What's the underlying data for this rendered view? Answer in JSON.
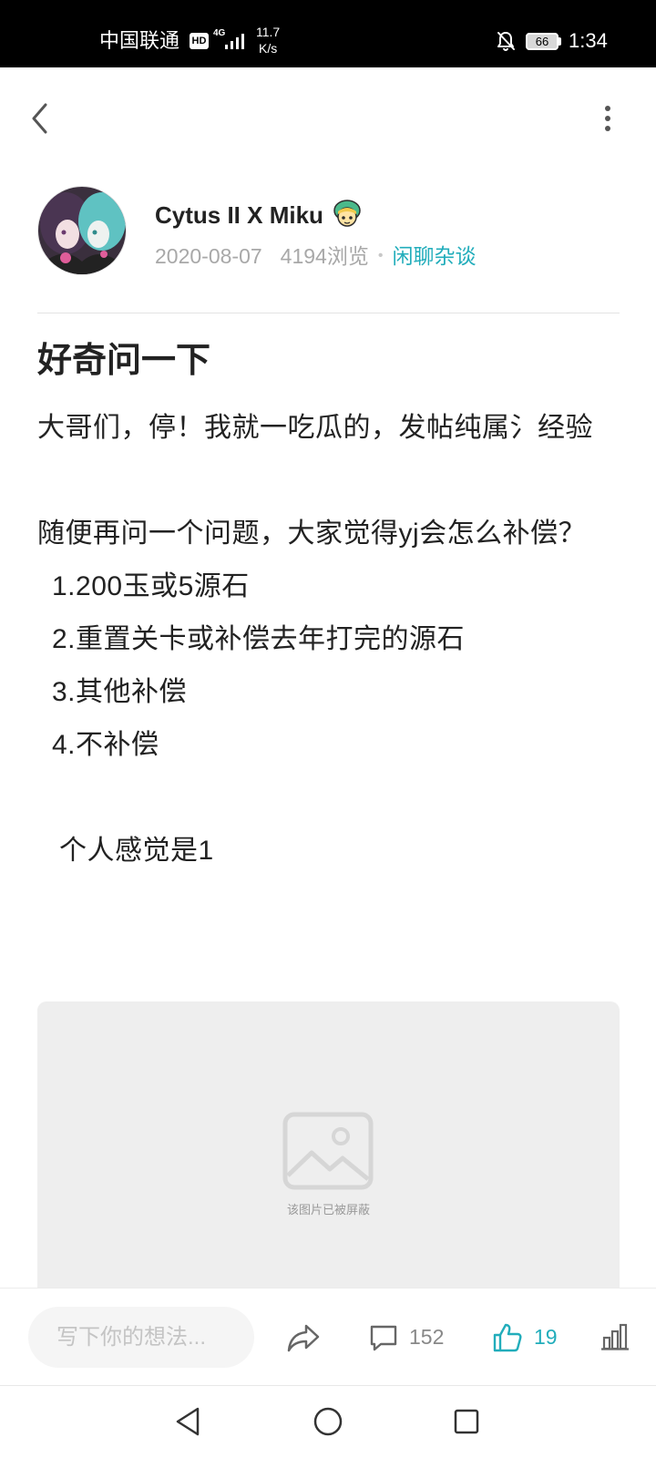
{
  "status_bar": {
    "carrier": "中国联通",
    "hd_badge": "HD",
    "network_type": "4G",
    "net_speed_value": "11.7",
    "net_speed_unit": "K/s",
    "battery_level": "66",
    "time": "1:34",
    "icons": [
      "signal-icon",
      "bell-off-icon",
      "battery-icon"
    ]
  },
  "top_nav": {
    "back_icon": "chevron-left-icon",
    "more_icon": "more-vertical-icon"
  },
  "author": {
    "name": "Cytus II X Miku",
    "badge_icon": "user-badge-icon",
    "date": "2020-08-07",
    "views": "4194浏览",
    "separator": "•",
    "category": "闲聊杂谈"
  },
  "post": {
    "title": "好奇问一下",
    "lines": [
      "大哥们，停！我就一吃瓜的，发帖纯属氵经验",
      "随便再问一个问题，大家觉得yj会怎么补偿？",
      "1.200玉或5源石",
      "2.重置关卡或补偿去年打完的源石",
      "3.其他补偿",
      "4.不补偿",
      "个人感觉是1"
    ]
  },
  "image": {
    "icon": "image-placeholder-icon",
    "caption": "该图片已被屏蔽"
  },
  "action_bar": {
    "comment_placeholder": "写下你的想法...",
    "share_icon": "share-icon",
    "comment_icon": "comment-icon",
    "comment_count": "152",
    "like_icon": "thumbs-up-icon",
    "like_count": "19",
    "liked": true,
    "stats_icon": "bar-chart-icon"
  },
  "system_nav": {
    "back_icon": "triangle-back-icon",
    "home_icon": "circle-home-icon",
    "recents_icon": "square-recents-icon"
  },
  "colors": {
    "status_bar": "#000000",
    "accent": "#22adbb",
    "text_primary": "#222222",
    "text_secondary": "#a8a8a8",
    "image_placeholder_bg": "#eeeeee"
  }
}
